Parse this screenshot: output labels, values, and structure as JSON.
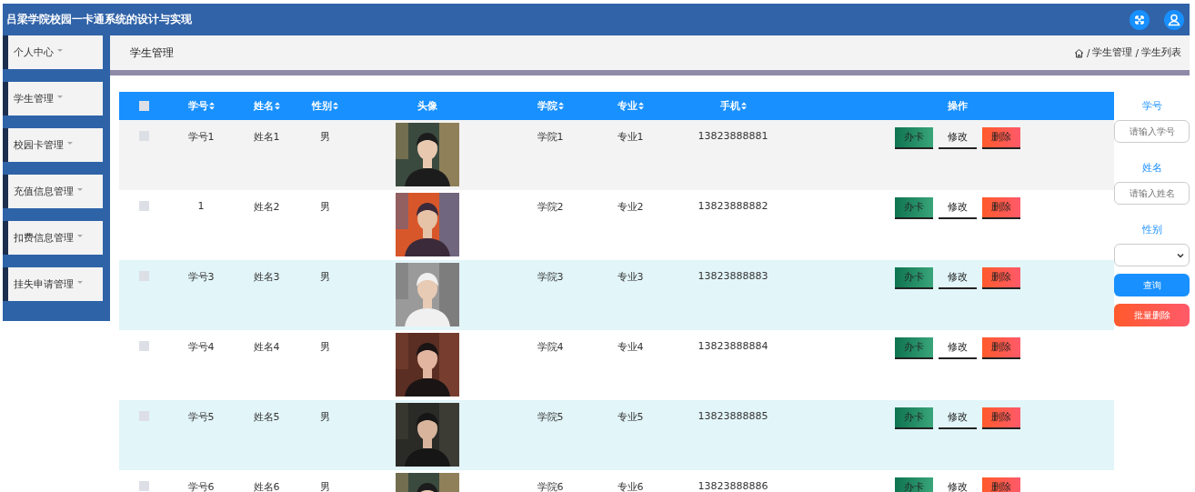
{
  "header": {
    "title": "吕梁学院校园一卡通系统的设计与实现"
  },
  "sidebar": {
    "items": [
      {
        "label": "个人中心"
      },
      {
        "label": "学生管理"
      },
      {
        "label": "校园卡管理"
      },
      {
        "label": "充值信息管理"
      },
      {
        "label": "扣费信息管理"
      },
      {
        "label": "挂失申请管理"
      }
    ]
  },
  "page": {
    "title": "学生管理",
    "breadcrumb_separator": "/",
    "breadcrumb": [
      "学生管理",
      "学生列表"
    ]
  },
  "table": {
    "select_all": {
      "checked": false
    },
    "columns": [
      {
        "label": "学号",
        "sortable": true
      },
      {
        "label": "姓名",
        "sortable": true
      },
      {
        "label": "性别",
        "sortable": true
      },
      {
        "label": "头像",
        "sortable": false
      },
      {
        "label": "学院",
        "sortable": true
      },
      {
        "label": "专业",
        "sortable": true
      },
      {
        "label": "手机",
        "sortable": true
      },
      {
        "label": "操作",
        "sortable": false
      }
    ],
    "rows": [
      {
        "checked": false,
        "student_id": "学号1",
        "name": "姓名1",
        "gender": "男",
        "college": "学院1",
        "major": "专业1",
        "phone": "13823888881",
        "actions": [
          {
            "label": "办卡",
            "kind": "card"
          },
          {
            "label": "修改",
            "kind": "edit"
          },
          {
            "label": "删除",
            "kind": "delete"
          }
        ]
      },
      {
        "checked": false,
        "student_id": "1",
        "name": "姓名2",
        "gender": "男",
        "college": "学院2",
        "major": "专业2",
        "phone": "13823888882",
        "actions": [
          {
            "label": "办卡",
            "kind": "card"
          },
          {
            "label": "修改",
            "kind": "edit"
          },
          {
            "label": "删除",
            "kind": "delete"
          }
        ]
      },
      {
        "checked": false,
        "student_id": "学号3",
        "name": "姓名3",
        "gender": "男",
        "college": "学院3",
        "major": "专业3",
        "phone": "13823888883",
        "actions": [
          {
            "label": "办卡",
            "kind": "card"
          },
          {
            "label": "修改",
            "kind": "edit"
          },
          {
            "label": "删除",
            "kind": "delete"
          }
        ]
      },
      {
        "checked": false,
        "student_id": "学号4",
        "name": "姓名4",
        "gender": "男",
        "college": "学院4",
        "major": "专业4",
        "phone": "13823888884",
        "actions": [
          {
            "label": "办卡",
            "kind": "card"
          },
          {
            "label": "修改",
            "kind": "edit"
          },
          {
            "label": "删除",
            "kind": "delete"
          }
        ]
      },
      {
        "checked": false,
        "student_id": "学号5",
        "name": "姓名5",
        "gender": "男",
        "college": "学院5",
        "major": "专业5",
        "phone": "13823888885",
        "actions": [
          {
            "label": "办卡",
            "kind": "card"
          },
          {
            "label": "修改",
            "kind": "edit"
          },
          {
            "label": "删除",
            "kind": "delete"
          }
        ]
      },
      {
        "checked": false,
        "student_id": "学号6",
        "name": "姓名6",
        "gender": "男",
        "college": "学院6",
        "major": "专业6",
        "phone": "13823888886",
        "actions": [
          {
            "label": "办卡",
            "kind": "card"
          },
          {
            "label": "修改",
            "kind": "edit"
          },
          {
            "label": "删除",
            "kind": "delete"
          }
        ]
      }
    ]
  },
  "filters": [
    {
      "label": "学号",
      "kind": "text",
      "placeholder": "请输入学号"
    },
    {
      "label": "姓名",
      "kind": "text",
      "placeholder": "请输入姓名"
    },
    {
      "label": "性别",
      "kind": "select"
    }
  ],
  "buttons": [
    {
      "label": "查询",
      "kind": "search"
    },
    {
      "label": "批量删除",
      "kind": "delete"
    }
  ]
}
